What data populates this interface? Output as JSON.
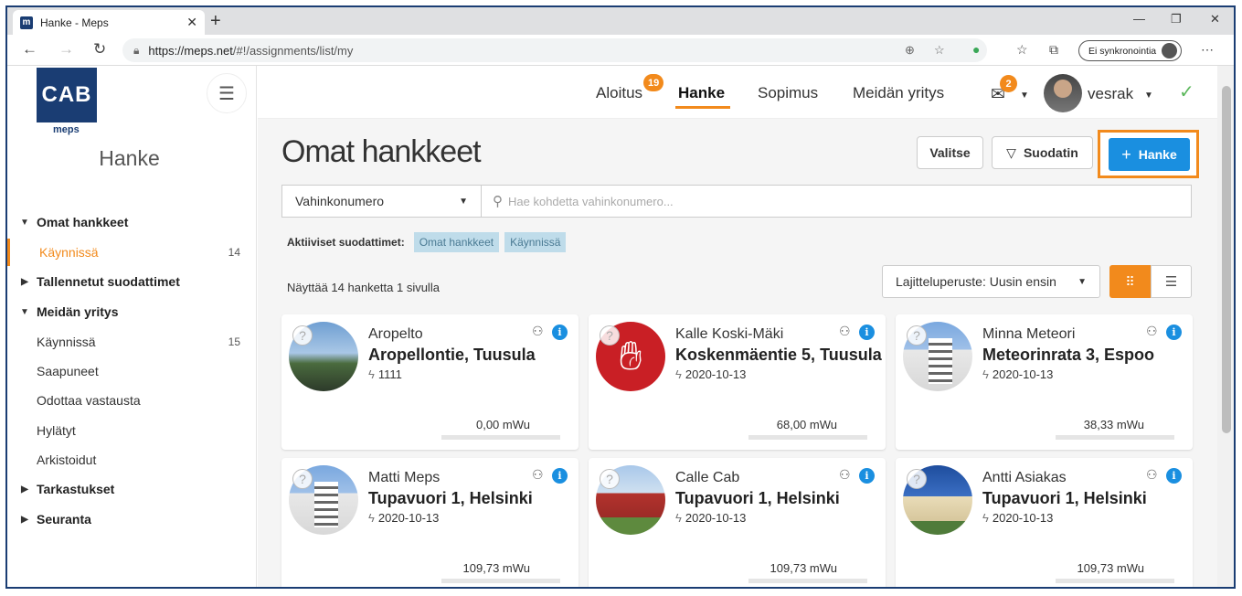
{
  "browser": {
    "tab_title": "Hanke - Meps",
    "favicon_letter": "m",
    "url_host": "https://meps.net",
    "url_path": "/#!/assignments/list/my",
    "sync_label": "Ei synkronointia"
  },
  "sidebar": {
    "logo_text": "CAB",
    "logo_sub": "meps",
    "title": "Hanke",
    "items": [
      {
        "label": "Omat hankkeet",
        "type": "group",
        "expanded": true
      },
      {
        "label": "Käynnissä",
        "type": "sub",
        "count": "14",
        "active": true
      },
      {
        "label": "Tallennetut suodattimet",
        "type": "group",
        "expanded": false
      },
      {
        "label": "Meidän yritys",
        "type": "group",
        "expanded": true
      },
      {
        "label": "Käynnissä",
        "type": "sub",
        "count": "15"
      },
      {
        "label": "Saapuneet",
        "type": "sub"
      },
      {
        "label": "Odottaa vastausta",
        "type": "sub"
      },
      {
        "label": "Hylätyt",
        "type": "sub"
      },
      {
        "label": "Arkistoidut",
        "type": "sub"
      },
      {
        "label": "Tarkastukset",
        "type": "group",
        "expanded": false
      },
      {
        "label": "Seuranta",
        "type": "group",
        "expanded": false
      }
    ]
  },
  "topnav": {
    "tabs": [
      {
        "label": "Aloitus",
        "badge": "19"
      },
      {
        "label": "Hanke",
        "active": true
      },
      {
        "label": "Sopimus"
      },
      {
        "label": "Meidän yritys"
      }
    ],
    "mail_badge": "2",
    "username": "vesrak"
  },
  "main": {
    "title": "Omat hankkeet",
    "select_button": "Valitse",
    "filter_button": "Suodatin",
    "new_button": "Hanke",
    "search_field": "Vahinkonumero",
    "search_placeholder": "Hae kohdetta vahinkonumero...",
    "active_filters_label": "Aktiiviset suodattimet:",
    "active_filters": [
      "Omat hankkeet",
      "Käynnissä"
    ],
    "count_text": "Näyttää 14 hanketta 1 sivulla",
    "sort_label": "Lajitteluperuste: Uusin ensin"
  },
  "cards": [
    {
      "name": "Aropelto",
      "address": "Aropellontie, Tuusula",
      "meta": "1111",
      "value": "0,00 mWu",
      "image": "landscape-photo"
    },
    {
      "name": "Kalle Koski-Mäki",
      "address": "Koskenmäentie 5, Tuusula",
      "meta": "2020-10-13",
      "value": "68,00 mWu",
      "image": "stop-hand-icon"
    },
    {
      "name": "Minna Meteori",
      "address": "Meteorinrata 3, Espoo",
      "meta": "2020-10-13",
      "value": "38,33 mWu",
      "image": "apartment-building-photo"
    },
    {
      "name": "Matti Meps",
      "address": "Tupavuori 1, Helsinki",
      "meta": "2020-10-13",
      "value": "109,73 mWu",
      "image": "apartment-building-photo"
    },
    {
      "name": "Calle Cab",
      "address": "Tupavuori 1, Helsinki",
      "meta": "2020-10-13",
      "value": "109,73 mWu",
      "image": "red-house-photo"
    },
    {
      "name": "Antti Asiakas",
      "address": "Tupavuori 1, Helsinki",
      "meta": "2020-10-13",
      "value": "109,73 mWu",
      "image": "villa-photo"
    }
  ],
  "colors": {
    "accent": "#f28a1c",
    "primary": "#1a8fe0",
    "brand": "#1a3d73"
  }
}
